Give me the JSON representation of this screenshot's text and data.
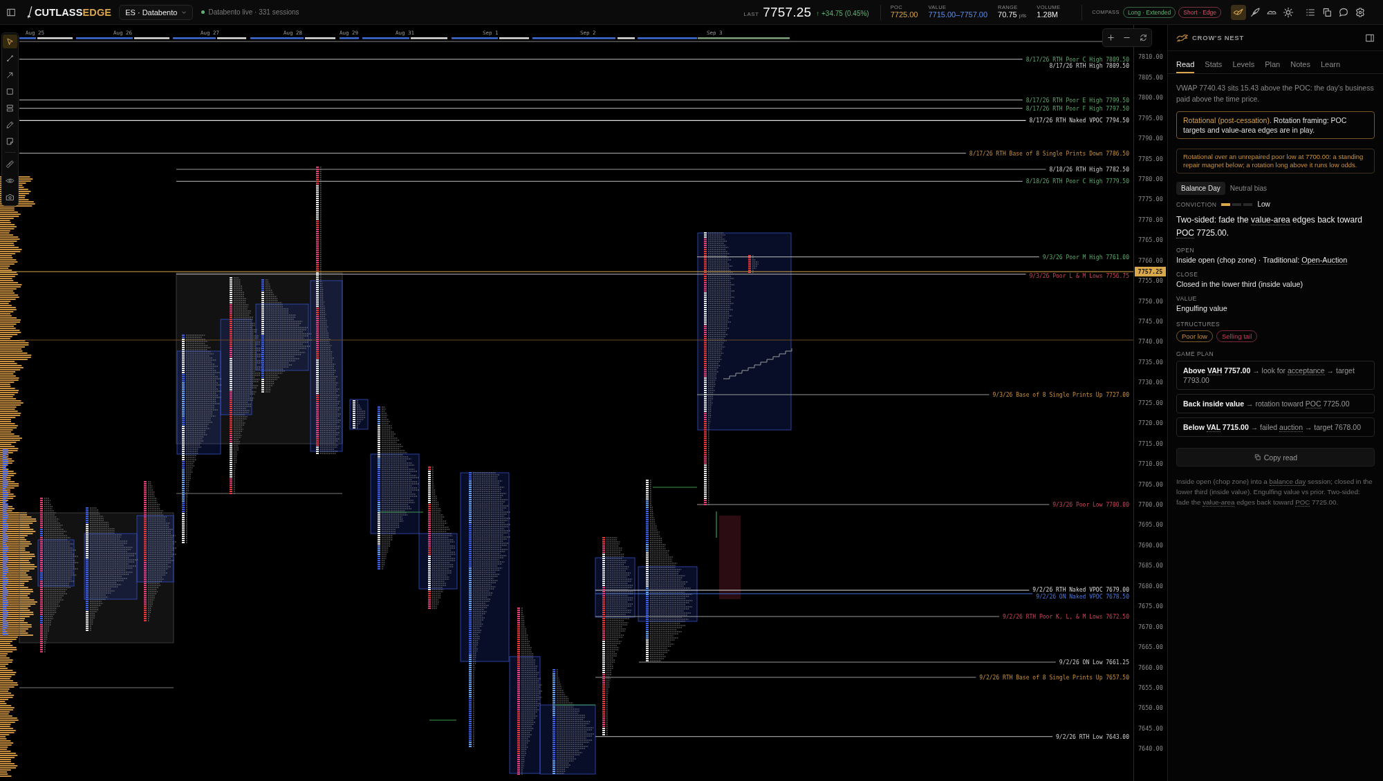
{
  "topbar": {
    "brand": "CUTLASS",
    "brand_accent": "EDGE",
    "instrument": "ES · Databento",
    "feed": {
      "live": true,
      "text": "Databento live · 331 sessions"
    },
    "quote": {
      "label": "LAST",
      "price": "7757.25",
      "change": "↑ +34.75 (0.45%)"
    },
    "stats": [
      {
        "label": "POC",
        "value": "7725.00",
        "kind": "poc"
      },
      {
        "label": "VALUE",
        "value": "7715.00–7757.00",
        "kind": "value"
      },
      {
        "label": "RANGE",
        "value": "70.75",
        "unit": "pts",
        "kind": "range"
      },
      {
        "label": "VOLUME",
        "value": "1.28M",
        "kind": "volume"
      }
    ],
    "compass": {
      "label": "COMPASS",
      "badges": [
        {
          "text": "Long · Extended",
          "kind": "long"
        },
        {
          "text": "Short · Edge",
          "kind": "short"
        }
      ]
    },
    "views": [
      {
        "selected": true
      },
      {
        "selected": false
      },
      {
        "selected": false
      },
      {
        "selected": false
      }
    ]
  },
  "toolbar": {
    "tools": [
      {
        "selected": true
      },
      {
        "selected": false
      },
      {
        "selected": false
      },
      {
        "selected": false
      },
      {
        "selected": false
      },
      {
        "selected": false
      },
      {
        "selected": false
      },
      {
        "selected": false
      },
      {
        "selected": false
      },
      {
        "selected": false
      }
    ]
  },
  "chart": {
    "dates": [
      "Aug 25",
      "Aug 26",
      "Aug 27",
      "Aug 28",
      "Aug 29",
      "Aug 31",
      "Sep 1",
      "Sep 2",
      "Sep 3"
    ],
    "price_ticks": [
      "7810.00",
      "7805.00",
      "7800.00",
      "7795.00",
      "7790.00",
      "7785.00",
      "7780.00",
      "7775.00",
      "7770.00",
      "7765.00",
      "7760.00",
      "7755.00",
      "7750.00",
      "7745.00",
      "7740.00",
      "7735.00",
      "7730.00",
      "7725.00",
      "7720.00",
      "7715.00",
      "7710.00",
      "7705.00",
      "7700.00",
      "7695.00",
      "7690.00",
      "7685.00",
      "7680.00",
      "7675.00",
      "7670.00",
      "7665.00",
      "7660.00",
      "7655.00",
      "7650.00",
      "7645.00",
      "7640.00"
    ],
    "last_price": "7757.25",
    "levels": [
      {
        "label": "8/17/26 RTH Poor C High 7809.50",
        "kind": "poor-high"
      },
      {
        "label": "8/17/26 RTH High 7809.50",
        "kind": "high"
      },
      {
        "label": "8/17/26 RTH Poor E High 7799.50",
        "kind": "poor-high"
      },
      {
        "label": "8/17/26 RTH Poor F High 7797.50",
        "kind": "poor-high"
      },
      {
        "label": "8/17/26 RTH Naked VPOC 7794.50",
        "kind": "vpoc"
      },
      {
        "label": "8/17/26 RTH Base of 8 Single Prints Down 7786.50",
        "kind": "single-prints"
      },
      {
        "label": "8/18/26 RTH High 7782.50",
        "kind": "high"
      },
      {
        "label": "8/18/26 RTH Poor C High 7779.50",
        "kind": "poor-high"
      },
      {
        "label": "9/3/26 Poor M High 7761.00",
        "kind": "poor-high"
      },
      {
        "label": "9/3/26 Poor L & M Lows 7756.75",
        "kind": "poor-low"
      },
      {
        "label": "9/3/26 Base of 8 Single Prints Up 7727.00",
        "kind": "single-prints"
      },
      {
        "label": "9/3/26 Poor Low 7700.00",
        "kind": "poor-low"
      },
      {
        "label": "9/2/26 RTH Naked VPOC 7679.00",
        "kind": "vpoc"
      },
      {
        "label": "9/2/26 ON Naked VPOC 7678.50",
        "kind": "overnight-vpoc"
      },
      {
        "label": "9/2/26 RTH Poor K, L, & M Lows 7672.50",
        "kind": "poor-low"
      },
      {
        "label": "9/2/26 ON Low 7661.25",
        "kind": "low"
      },
      {
        "label": "9/2/26 RTH Base of 8 Single Prints Up 7657.50",
        "kind": "single-prints"
      },
      {
        "label": "9/2/26 RTH Low 7643.00",
        "kind": "low"
      }
    ]
  },
  "panel": {
    "title": "CROW'S NEST",
    "tabs": [
      {
        "label": "Read",
        "selected": true
      },
      {
        "label": "Stats",
        "selected": false
      },
      {
        "label": "Levels",
        "selected": false
      },
      {
        "label": "Plan",
        "selected": false
      },
      {
        "label": "Notes",
        "selected": false
      },
      {
        "label": "Learn",
        "selected": false
      }
    ],
    "intro": "VWAP 7740.43 sits 15.43 above the POC: the day's business paid above the time price.",
    "regime": {
      "lead": "Rotational (post-cessation).",
      "text": "Rotation framing: POC targets and value-area edges are in play."
    },
    "warning": "Rotational over an unrepaired poor low at 7700.00: a standing repair magnet below; a rotation long above it runs low odds.",
    "day_type": "Balance Day",
    "bias": "Neutral bias",
    "conviction": {
      "label": "CONVICTION",
      "level": 0.33,
      "text": "Low"
    },
    "thesis": [
      {
        "kind": "text",
        "text": "Two-sided: fade the "
      },
      {
        "kind": "term",
        "text": "value-area"
      },
      {
        "kind": "text",
        "text": " edges back toward "
      },
      {
        "kind": "term",
        "text": "POC"
      },
      {
        "kind": "text",
        "text": " 7725.00."
      }
    ],
    "facts": [
      {
        "label": "OPEN",
        "value": [
          {
            "kind": "text",
            "text": "Inside open (chop zone) · Traditional: "
          },
          {
            "kind": "term",
            "text": "Open-Auction"
          }
        ]
      },
      {
        "label": "CLOSE",
        "value": [
          {
            "kind": "text",
            "text": "Closed in the lower third (inside value)"
          }
        ]
      },
      {
        "label": "VALUE",
        "value": [
          {
            "kind": "text",
            "text": "Engulfing value"
          }
        ]
      }
    ],
    "structures": {
      "label": "STRUCTURES",
      "tags": [
        {
          "text": "Poor low",
          "kind": "caution"
        },
        {
          "text": "Selling tail",
          "kind": "bearish"
        }
      ]
    },
    "game_plan": {
      "label": "GAME PLAN",
      "items": [
        {
          "head": [
            {
              "kind": "text",
              "text": "Above "
            },
            {
              "kind": "term",
              "text": "VAH"
            },
            {
              "kind": "text",
              "text": " 7757.00"
            }
          ],
          "tail": [
            {
              "kind": "text",
              "text": " → look for "
            },
            {
              "kind": "term",
              "text": "acceptance"
            },
            {
              "kind": "text",
              "text": " → target 7793.00"
            }
          ]
        },
        {
          "head": [
            {
              "kind": "text",
              "text": "Back inside value"
            }
          ],
          "tail": [
            {
              "kind": "text",
              "text": " → rotation toward "
            },
            {
              "kind": "term",
              "text": "POC"
            },
            {
              "kind": "text",
              "text": " 7725.00"
            }
          ]
        },
        {
          "head": [
            {
              "kind": "text",
              "text": "Below "
            },
            {
              "kind": "term",
              "text": "VAL"
            },
            {
              "kind": "text",
              "text": " 7715.00"
            }
          ],
          "tail": [
            {
              "kind": "text",
              "text": " → failed "
            },
            {
              "kind": "term",
              "text": "auction"
            },
            {
              "kind": "text",
              "text": " → target 7678.00"
            }
          ]
        }
      ]
    },
    "copy_button": "Copy read",
    "summary": [
      {
        "kind": "text",
        "text": "Inside open (chop zone) into a "
      },
      {
        "kind": "term",
        "text": "balance day"
      },
      {
        "kind": "text",
        "text": " session; closed in the lower third (inside value). Engulfing value vs prior. Two-sided: fade the "
      },
      {
        "kind": "term",
        "text": "value-area"
      },
      {
        "kind": "text",
        "text": " edges back toward "
      },
      {
        "kind": "term",
        "text": "POC"
      },
      {
        "kind": "text",
        "text": " 7725.00."
      }
    ]
  }
}
